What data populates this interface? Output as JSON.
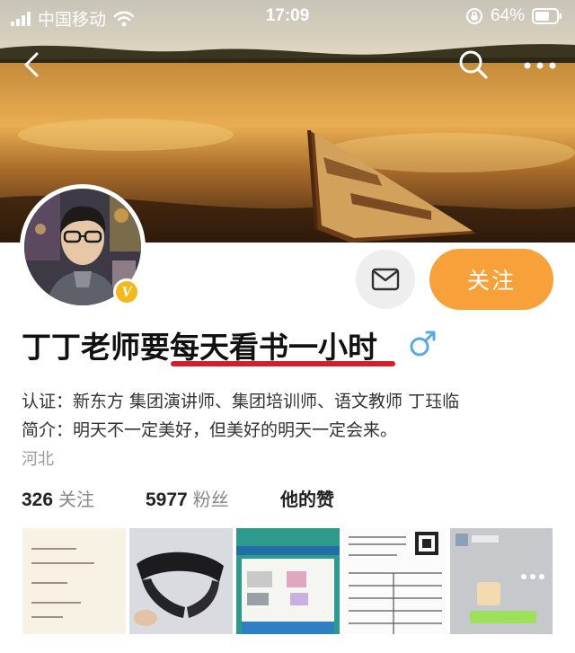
{
  "status_bar": {
    "carrier": "中国移动",
    "time": "17:09",
    "battery": "64%"
  },
  "profile": {
    "name": "丁丁老师要每天看书一小时",
    "verification": "认证：新东方 集团演讲师、集团培训师、语文教师 丁珏临",
    "bio": "简介：明天不一定美好，但美好的明天一定会来。",
    "region": "河北",
    "follow_label": "关注",
    "verified_badge": "V"
  },
  "stats": {
    "following_count": "326",
    "following_label": "关注",
    "followers_count": "5977",
    "followers_label": "粉丝",
    "likes_label": "他的赞"
  },
  "colors": {
    "accent": "#f8a13a",
    "underline": "#d2202a",
    "gender": "#5aa7e6",
    "badge": "#f4b81a"
  },
  "icons": [
    "back-icon",
    "search-icon",
    "more-icon",
    "message-icon",
    "male-icon",
    "wifi-icon",
    "lock-rotation-icon"
  ]
}
